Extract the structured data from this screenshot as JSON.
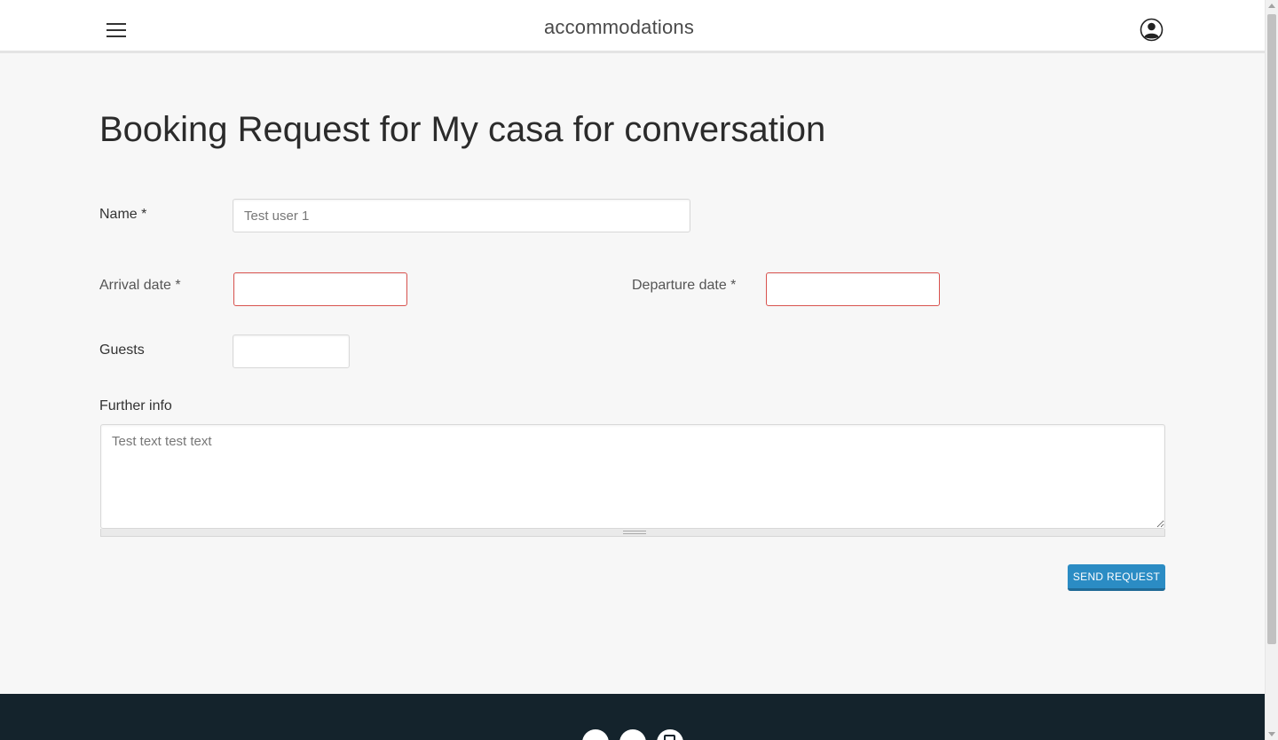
{
  "header": {
    "brand": "accommodations",
    "menu_icon": "hamburger-menu-icon",
    "user_icon": "user-account-icon"
  },
  "page": {
    "title": "Booking Request for My casa for conversation"
  },
  "form": {
    "name_label": "Name *",
    "name_value": "Test user 1",
    "arrival_label": "Arrival date *",
    "arrival_value": "",
    "departure_label": "Departure date *",
    "departure_value": "",
    "guests_label": "Guests",
    "guests_value": "",
    "further_info_label": "Further info",
    "further_info_value": "Test text test text",
    "submit_label": "SEND REQUEST"
  },
  "colors": {
    "accent": "#2b8cc4",
    "error_border": "#d9534f",
    "footer_bg": "#14232c"
  },
  "footer": {
    "social_icons": [
      "facebook-icon",
      "twitter-icon",
      "instagram-icon"
    ]
  }
}
